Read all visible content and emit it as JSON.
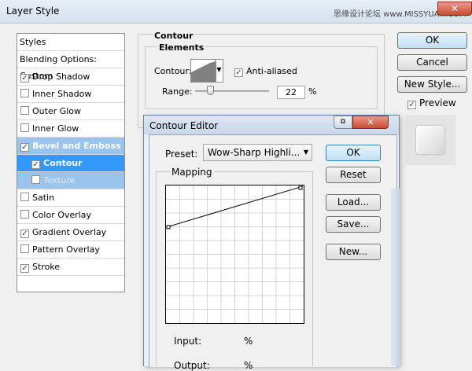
{
  "window": {
    "title": "Layer Style",
    "watermark": "思缘设计论坛 www.MISSYUAN.COM",
    "close_glyph": "✕"
  },
  "styles_panel": {
    "header": "Styles",
    "blending": "Blending Options: Custom",
    "items": [
      {
        "label": "Drop Shadow",
        "checked": true
      },
      {
        "label": "Inner Shadow",
        "checked": false
      },
      {
        "label": "Outer Glow",
        "checked": false
      },
      {
        "label": "Inner Glow",
        "checked": false
      },
      {
        "label": "Bevel and Emboss",
        "checked": true
      },
      {
        "label": "Contour",
        "checked": true
      },
      {
        "label": "Texture",
        "checked": false
      },
      {
        "label": "Satin",
        "checked": false
      },
      {
        "label": "Color Overlay",
        "checked": false
      },
      {
        "label": "Gradient Overlay",
        "checked": true
      },
      {
        "label": "Pattern Overlay",
        "checked": false
      },
      {
        "label": "Stroke",
        "checked": true
      }
    ]
  },
  "contour_section": {
    "title": "Contour",
    "elements_title": "Elements",
    "contour_label": "Contour:",
    "anti_aliased": "Anti-aliased",
    "range_label": "Range:",
    "range_value": "22",
    "range_unit": "%",
    "range_fraction": 0.22
  },
  "buttons": {
    "ok": "OK",
    "cancel": "Cancel",
    "new_style": "New Style...",
    "preview": "Preview"
  },
  "contour_editor": {
    "title": "Contour Editor",
    "restore_glyph": "⧉",
    "close_glyph": "✕",
    "preset_label": "Preset:",
    "preset_value": "Wow-Sharp Highli...",
    "ok": "OK",
    "reset": "Reset",
    "load": "Load...",
    "save": "Save...",
    "new": "New...",
    "mapping_title": "Mapping",
    "input_label": "Input:",
    "input_pct": "%",
    "output_label": "Output:",
    "output_pct": "%",
    "curve_points": [
      [
        0,
        70
      ],
      [
        100,
        100
      ]
    ]
  },
  "colors": {
    "selection_light": "#99c4ee",
    "selection_dark": "#3399ff",
    "close_red": "#c94b34"
  }
}
